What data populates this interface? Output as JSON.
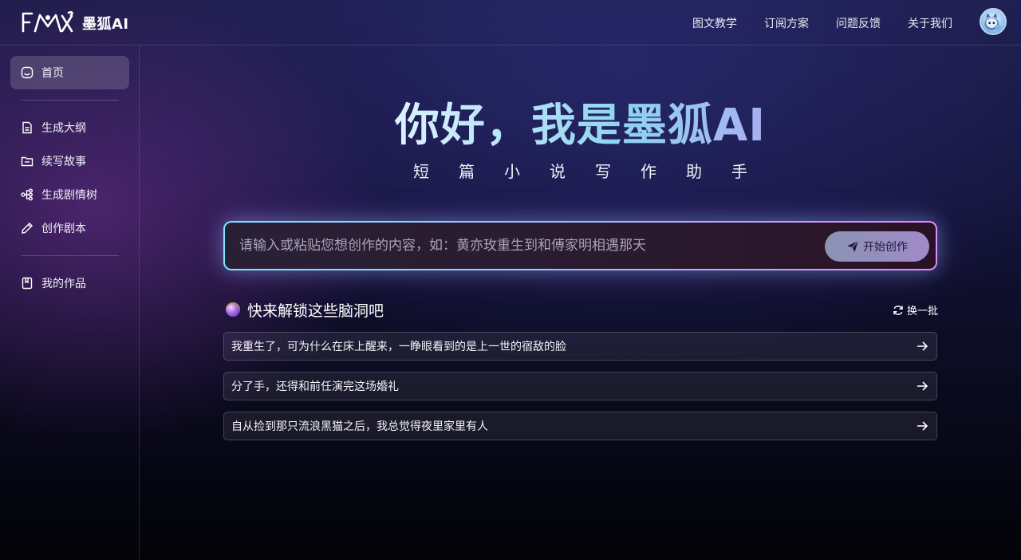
{
  "header": {
    "brand": "墨狐AI",
    "nav": [
      "图文教学",
      "订阅方案",
      "问题反馈",
      "关于我们"
    ]
  },
  "sidebar": {
    "items": [
      {
        "label": "首页",
        "icon": "home-icon",
        "active": true
      },
      {
        "label": "生成大纲",
        "icon": "document-icon"
      },
      {
        "label": "续写故事",
        "icon": "folder-icon"
      },
      {
        "label": "生成剧情树",
        "icon": "tree-icon"
      },
      {
        "label": "创作剧本",
        "icon": "pencil-icon"
      },
      {
        "label": "我的作品",
        "icon": "bookmark-icon"
      }
    ]
  },
  "hero": {
    "title": "你好，我是墨狐AI",
    "subtitle": "短篇小说写作助手"
  },
  "prompt": {
    "placeholder": "请输入或粘贴您想创作的内容，如：黄亦玫重生到和傅家明相遇那天",
    "button": "开始创作"
  },
  "ideas": {
    "title": "快来解锁这些脑洞吧",
    "refresh": "换一批",
    "items": [
      "我重生了，可为什么在床上醒来，一睁眼看到的是上一世的宿敌的脸",
      "分了手，还得和前任演完这场婚礼",
      "自从捡到那只流浪黑猫之后，我总觉得夜里家里有人"
    ]
  },
  "colors": {
    "accent_cyan": "#7fe6ff",
    "accent_purple": "#d46cf1",
    "background": "#14143a"
  }
}
